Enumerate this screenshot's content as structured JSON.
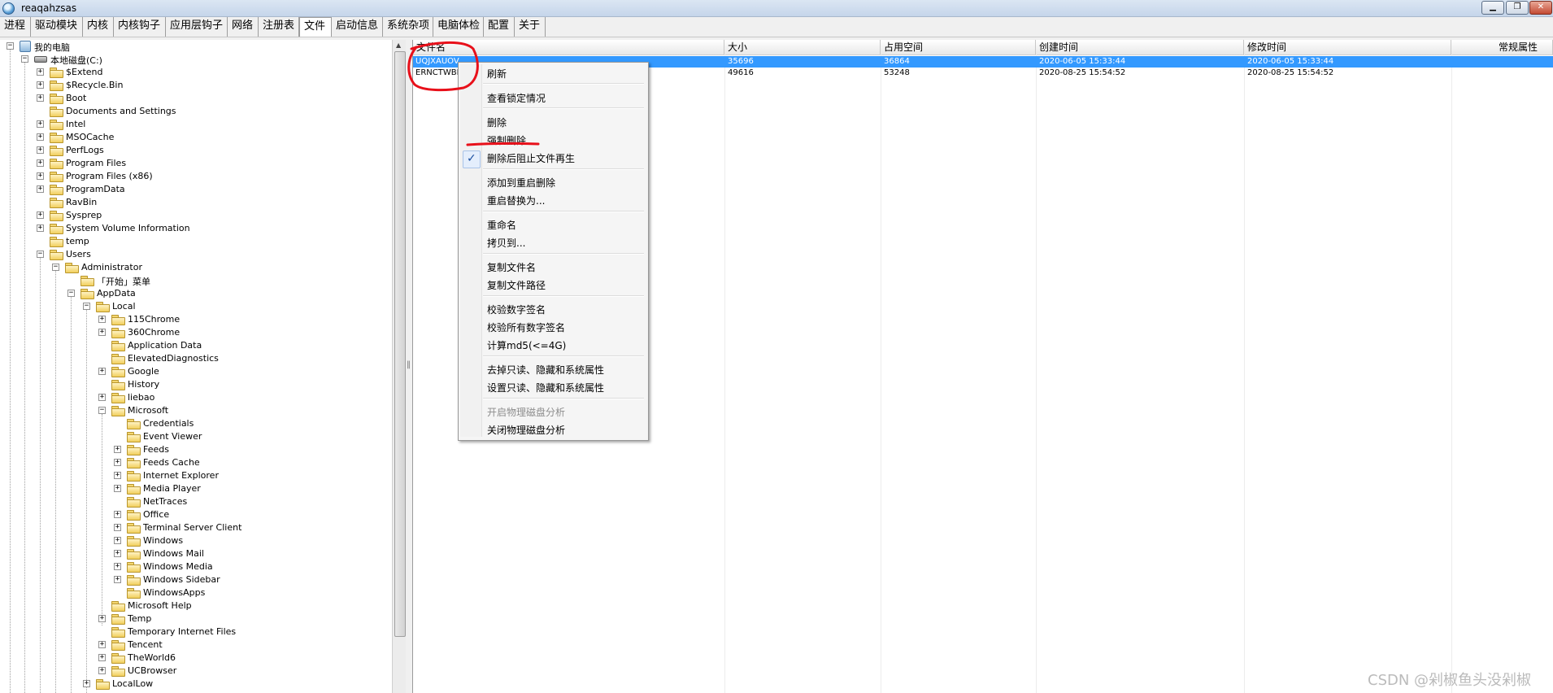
{
  "window": {
    "title": "reaqahzsas",
    "buttons": {
      "minimize": "▁",
      "restore": "❐",
      "close": "✕"
    }
  },
  "menu": [
    "进程",
    "驱动模块",
    "内核",
    "内核钩子",
    "应用层钩子",
    "网络",
    "注册表",
    "文件",
    "启动信息",
    "系统杂项",
    "电脑体检",
    "配置",
    "关于"
  ],
  "menu_active": "文件",
  "tree": {
    "root": "我的电脑",
    "drive": "本地磁盘(C:)",
    "nodes": [
      "$Extend",
      "$Recycle.Bin",
      "Boot",
      "Documents and Settings",
      "Intel",
      "MSOCache",
      "PerfLogs",
      "Program Files",
      "Program Files (x86)",
      "ProgramData",
      "RavBin",
      "Sysprep",
      "System Volume Information",
      "temp",
      "Users",
      "Administrator",
      "「开始」菜单",
      "AppData",
      "Local",
      "115Chrome",
      "360Chrome",
      "Application Data",
      "ElevatedDiagnostics",
      "Google",
      "History",
      "liebao",
      "Microsoft",
      "Credentials",
      "Event Viewer",
      "Feeds",
      "Feeds Cache",
      "Internet Explorer",
      "Media Player",
      "NetTraces",
      "Office",
      "Terminal Server Client",
      "Windows",
      "Windows Mail",
      "Windows Media",
      "Windows Sidebar",
      "WindowsApps",
      "Microsoft Help",
      "Temp",
      "Temporary Internet Files",
      "Tencent",
      "TheWorld6",
      "UCBrowser",
      "LocalLow"
    ]
  },
  "file_list": {
    "columns": [
      "文件名",
      "大小",
      "占用空间",
      "创建时间",
      "修改时间",
      "常规属性"
    ],
    "rows": [
      [
        "UQJXAUOV",
        "35696",
        "36864",
        "2020-06-05 15:33:44",
        "2020-06-05 15:33:44",
        ""
      ],
      [
        "ERNCTWBN",
        "49616",
        "53248",
        "2020-08-25 15:54:52",
        "2020-08-25 15:54:52",
        ""
      ]
    ],
    "selected_row": 0
  },
  "context_menu": {
    "items": [
      "刷新",
      "查看锁定情况",
      "删除",
      "强制删除",
      "删除后阻止文件再生",
      "添加到重启删除",
      "重启替换为...",
      "重命名",
      "拷贝到...",
      "复制文件名",
      "复制文件路径",
      "校验数字签名",
      "校验所有数字签名",
      "计算md5(<=4G)",
      "去掉只读、隐藏和系统属性",
      "设置只读、隐藏和系统属性",
      "开启物理磁盘分析",
      "关闭物理磁盘分析"
    ],
    "checked_item": "删除后阻止文件再生",
    "disabled_item": "开启物理磁盘分析",
    "check_mark": "✓"
  },
  "watermark": "CSDN @剁椒鱼头没剁椒",
  "icons": {
    "expand": "+",
    "collapse": "−",
    "scroll_up": "▲",
    "splitter_grip": "‖"
  },
  "colors": {
    "selection": "#3399ff",
    "annotation": "#e8101a"
  }
}
